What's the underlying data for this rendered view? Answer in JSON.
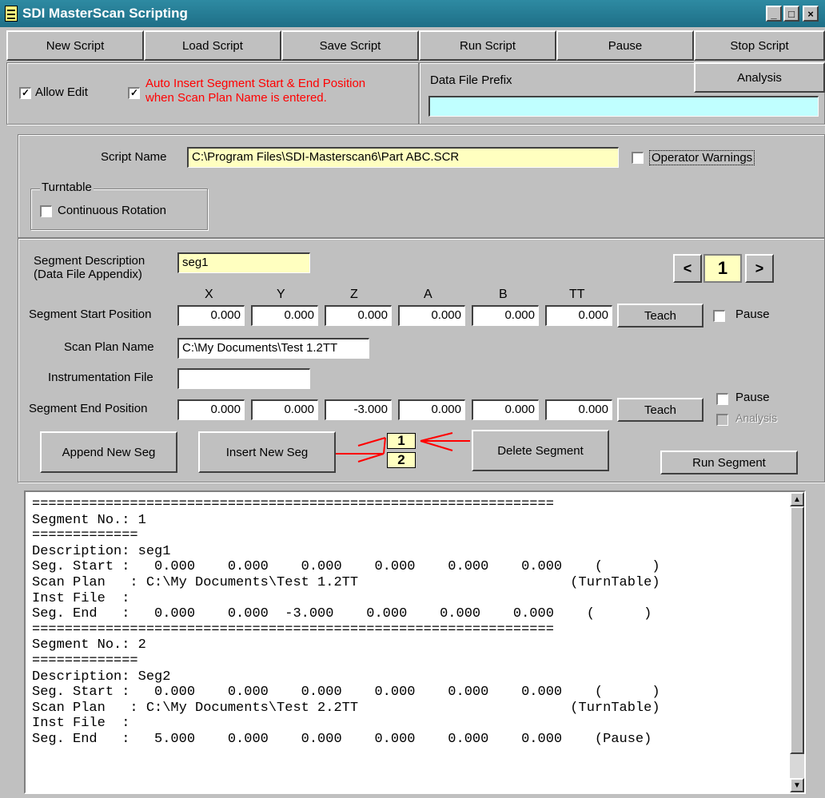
{
  "window": {
    "title": "SDI MasterScan Scripting"
  },
  "toolbar": {
    "new_script": "New Script",
    "load_script": "Load Script",
    "save_script": "Save Script",
    "run_script": "Run Script",
    "pause": "Pause",
    "stop_script": "Stop Script",
    "analysis": "Analysis"
  },
  "options": {
    "allow_edit_label": "Allow Edit",
    "allow_edit_checked": true,
    "auto_insert_line1": "Auto Insert Segment Start & End Position",
    "auto_insert_line2": "when Scan Plan Name is entered.",
    "auto_insert_checked": true,
    "auto_insert_color": "#ff0000",
    "data_file_prefix_label": "Data File Prefix",
    "data_file_prefix_value": "",
    "data_file_prefix_bg": "#c0ffff"
  },
  "script": {
    "name_label": "Script Name",
    "name_value": "C:\\Program Files\\SDI-Masterscan6\\Part ABC.SCR",
    "operator_warnings_label": "Operator Warnings",
    "turntable_group": "Turntable",
    "continuous_rotation_label": "Continuous Rotation"
  },
  "segment": {
    "description_label_1": "Segment Description",
    "description_label_2": "(Data File Appendix)",
    "description_value": "seg1",
    "nav_prev": "<",
    "nav_index": "1",
    "nav_next": ">",
    "axes": [
      "X",
      "Y",
      "Z",
      "A",
      "B",
      "TT"
    ],
    "start_label": "Segment Start Position",
    "start_values": [
      "0.000",
      "0.000",
      "0.000",
      "0.000",
      "0.000",
      "0.000"
    ],
    "teach_label": "Teach",
    "pause_label": "Pause",
    "scan_plan_label": "Scan Plan Name",
    "scan_plan_value": "C:\\My Documents\\Test 1.2TT",
    "instrumentation_label": "Instrumentation File",
    "instrumentation_value": "",
    "end_label": "Segment End Position",
    "end_values": [
      "0.000",
      "0.000",
      "-3.000",
      "0.000",
      "0.000",
      "0.000"
    ],
    "analysis_label": "Analysis",
    "append_button": "Append New Seg",
    "insert_button": "Insert New Seg",
    "list_item_1": "1",
    "list_item_2": "2",
    "delete_button": "Delete Segment",
    "run_segment_button": "Run Segment",
    "arrow_color": "#ff0000"
  },
  "log": {
    "lines": [
      "================================================================",
      "Segment No.: 1",
      "=============",
      "Description: seg1",
      "Seg. Start :   0.000    0.000    0.000    0.000    0.000    0.000    (      )",
      "Scan Plan   : C:\\My Documents\\Test 1.2TT                          (TurnTable)",
      "Inst File  :",
      "Seg. End   :   0.000    0.000  -3.000    0.000    0.000    0.000    (      )",
      "================================================================",
      "Segment No.: 2",
      "=============",
      "Description: Seg2",
      "Seg. Start :   0.000    0.000    0.000    0.000    0.000    0.000    (      )",
      "Scan Plan   : C:\\My Documents\\Test 2.2TT                          (TurnTable)",
      "Inst File  :",
      "Seg. End   :   5.000    0.000    0.000    0.000    0.000    0.000    (Pause)"
    ]
  }
}
